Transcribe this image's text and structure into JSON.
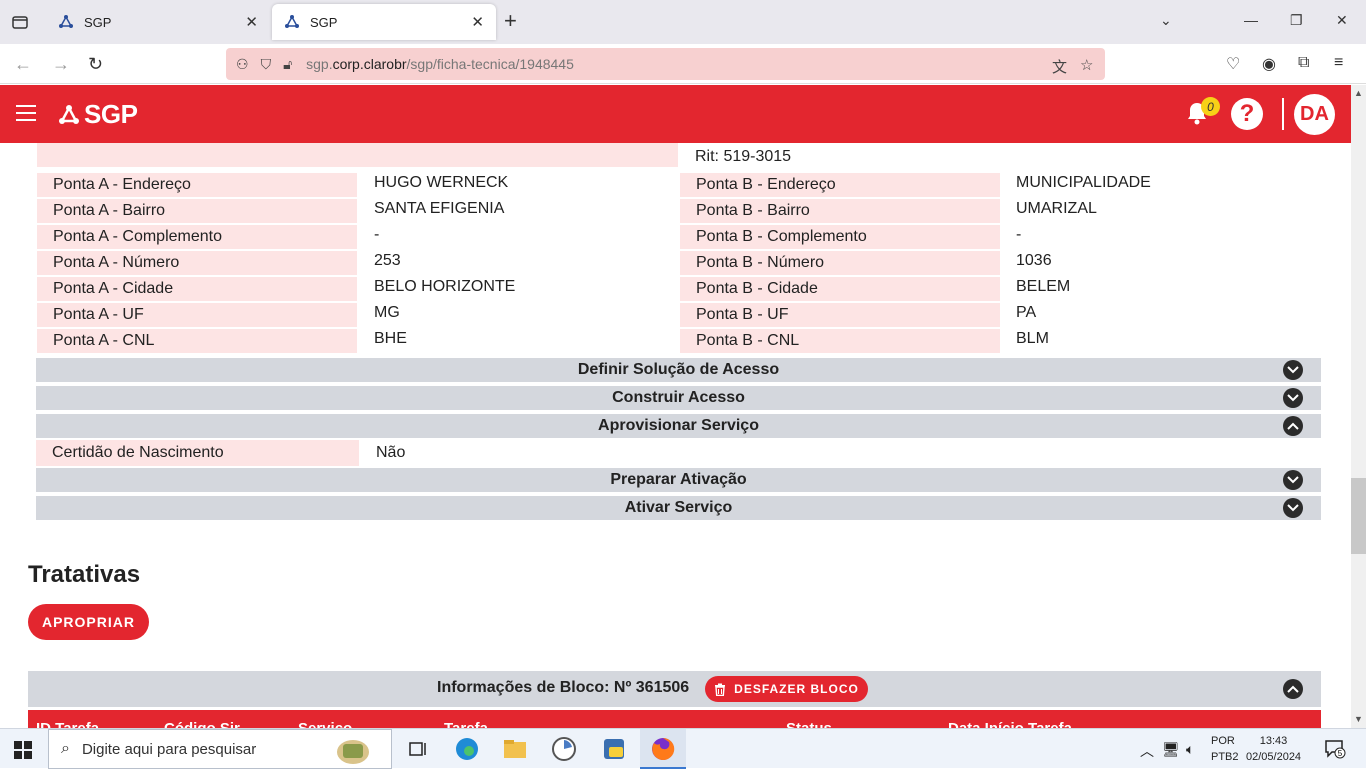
{
  "browser": {
    "tabs": [
      {
        "title": "SGP"
      },
      {
        "title": "SGP"
      }
    ],
    "url_prefix": "sgp.",
    "url_domain": "corp.clarobr",
    "url_path": "/sgp/ficha-tecnica/1948445"
  },
  "app": {
    "brand": "SGP",
    "notifications_count": "0",
    "help": "?",
    "user_initials": "DA"
  },
  "rit": "Rit: 519-3015",
  "ponta_a": [
    {
      "label": "Ponta A - Endereço",
      "value": "HUGO WERNECK"
    },
    {
      "label": "Ponta A - Bairro",
      "value": "SANTA EFIGENIA"
    },
    {
      "label": "Ponta A - Complemento",
      "value": "-"
    },
    {
      "label": "Ponta A - Número",
      "value": "253"
    },
    {
      "label": "Ponta A - Cidade",
      "value": "BELO HORIZONTE"
    },
    {
      "label": "Ponta A - UF",
      "value": "MG"
    },
    {
      "label": "Ponta A - CNL",
      "value": "BHE"
    }
  ],
  "ponta_b": [
    {
      "label": "Ponta B - Endereço",
      "value": "MUNICIPALIDADE"
    },
    {
      "label": "Ponta B - Bairro",
      "value": "UMARIZAL"
    },
    {
      "label": "Ponta B - Complemento",
      "value": "-"
    },
    {
      "label": "Ponta B - Número",
      "value": "1036"
    },
    {
      "label": "Ponta B - Cidade",
      "value": "BELEM"
    },
    {
      "label": "Ponta B - UF",
      "value": "PA"
    },
    {
      "label": "Ponta B - CNL",
      "value": "BLM"
    }
  ],
  "sections": {
    "definir": "Definir Solução de Acesso",
    "construir": "Construir Acesso",
    "aprovisionar": "Aprovisionar Serviço",
    "preparar": "Preparar Ativação",
    "ativar": "Ativar Serviço"
  },
  "aprovisionar_field": {
    "label": "Certidão de Nascimento",
    "value": "Não"
  },
  "tratativas": {
    "title": "Tratativas",
    "apropriar_label": "APROPRIAR"
  },
  "bloco": {
    "title": "Informações de Bloco: Nº 361506",
    "desfazer_label": "DESFAZER BLOCO",
    "columns": [
      "ID Tarefa",
      "Código Sir",
      "Serviço",
      "Tarefa",
      "Status",
      "Data Início Tarefa"
    ]
  },
  "taskbar": {
    "search_placeholder": "Digite aqui para pesquisar",
    "lang_1": "POR",
    "lang_2": "PTB2",
    "time": "13:43",
    "date": "02/05/2024",
    "notif_count": "5"
  },
  "colors": {
    "brand_red": "#e3262f",
    "pink_label": "#fde4e4",
    "section_gray": "#d4d7dd"
  }
}
